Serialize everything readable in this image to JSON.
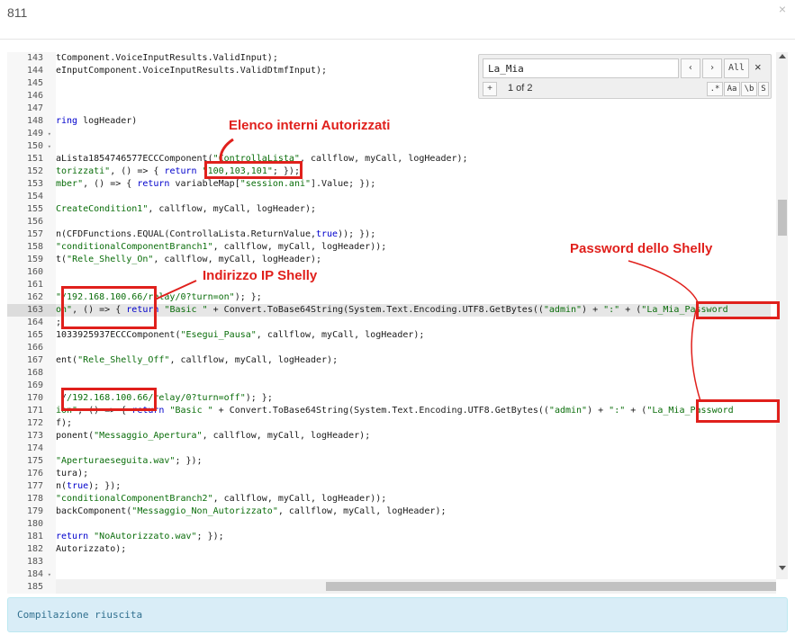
{
  "modal": {
    "title": "811",
    "close_glyph": "×"
  },
  "editor": {
    "lines": [
      {
        "n": "143",
        "fold": "",
        "segs": [
          {
            "t": "tComponent.VoiceInputResults.ValidInput);"
          }
        ]
      },
      {
        "n": "144",
        "fold": "",
        "segs": [
          {
            "t": "eInputComponent.VoiceInputResults.ValidDtmfInput);"
          }
        ]
      },
      {
        "n": "145",
        "fold": "",
        "segs": []
      },
      {
        "n": "146",
        "fold": "",
        "segs": []
      },
      {
        "n": "147",
        "fold": "",
        "segs": []
      },
      {
        "n": "148",
        "fold": "",
        "segs": [
          {
            "t": "ring",
            "c": "kw"
          },
          {
            "t": " logHeader)"
          }
        ]
      },
      {
        "n": "149",
        "fold": "▾",
        "segs": []
      },
      {
        "n": "150",
        "fold": "▾",
        "segs": []
      },
      {
        "n": "151",
        "fold": "",
        "segs": [
          {
            "t": "aLista1854746577ECCComponent("
          },
          {
            "t": "\"ControllaLista\"",
            "c": "str"
          },
          {
            "t": ", callflow, myCall, logHeader);"
          }
        ]
      },
      {
        "n": "152",
        "fold": "",
        "segs": [
          {
            "t": "torizzati\"",
            "c": "str"
          },
          {
            "t": ", () => { "
          },
          {
            "t": "return",
            "c": "kw"
          },
          {
            "t": " "
          },
          {
            "t": "\"100,103,101\"",
            "c": "str"
          },
          {
            "t": "; });"
          }
        ]
      },
      {
        "n": "153",
        "fold": "",
        "segs": [
          {
            "t": "mber\"",
            "c": "str"
          },
          {
            "t": ", () => { "
          },
          {
            "t": "return",
            "c": "kw"
          },
          {
            "t": " variableMap["
          },
          {
            "t": "\"session.ani\"",
            "c": "str"
          },
          {
            "t": "].Value; });"
          }
        ]
      },
      {
        "n": "154",
        "fold": "",
        "segs": []
      },
      {
        "n": "155",
        "fold": "",
        "segs": [
          {
            "t": "CreateCondition1\"",
            "c": "str"
          },
          {
            "t": ", callflow, myCall, logHeader);"
          }
        ]
      },
      {
        "n": "156",
        "fold": "",
        "segs": []
      },
      {
        "n": "157",
        "fold": "",
        "segs": [
          {
            "t": "n(CFDFunctions.EQUAL(ControllaLista.ReturnValue,"
          },
          {
            "t": "true",
            "c": "kw"
          },
          {
            "t": ")); });"
          }
        ]
      },
      {
        "n": "158",
        "fold": "",
        "segs": [
          {
            "t": "\"conditionalComponentBranch1\"",
            "c": "str"
          },
          {
            "t": ", callflow, myCall, logHeader));"
          }
        ]
      },
      {
        "n": "159",
        "fold": "",
        "segs": [
          {
            "t": "t("
          },
          {
            "t": "\"Rele_Shelly_On\"",
            "c": "str"
          },
          {
            "t": ", callflow, myCall, logHeader);"
          }
        ]
      },
      {
        "n": "160",
        "fold": "",
        "segs": []
      },
      {
        "n": "161",
        "fold": "",
        "segs": []
      },
      {
        "n": "162",
        "fold": "",
        "segs": [
          {
            "t": "\"/192.168.100.66/relay/0?turn=on\"",
            "c": "str"
          },
          {
            "t": "); };"
          }
        ]
      },
      {
        "n": "163",
        "fold": "",
        "segs": [
          {
            "t": "on\"",
            "c": "str"
          },
          {
            "t": ", () => { "
          },
          {
            "t": "return",
            "c": "kw"
          },
          {
            "t": " "
          },
          {
            "t": "\"Basic \"",
            "c": "str"
          },
          {
            "t": " + Convert.ToBase64String(System.Text.Encoding.UTF8.GetBytes(("
          },
          {
            "t": "\"admin\"",
            "c": "str"
          },
          {
            "t": ") + "
          },
          {
            "t": "\":\"",
            "c": "str"
          },
          {
            "t": " + ("
          },
          {
            "t": "\"La_Mia_Password",
            "c": "str"
          }
        ]
      },
      {
        "n": "164",
        "fold": "",
        "segs": [
          {
            "t": ";"
          }
        ]
      },
      {
        "n": "165",
        "fold": "",
        "segs": [
          {
            "t": "1033925937ECCComponent("
          },
          {
            "t": "\"Esegui_Pausa\"",
            "c": "str"
          },
          {
            "t": ", callflow, myCall, logHeader);"
          }
        ]
      },
      {
        "n": "166",
        "fold": "",
        "segs": []
      },
      {
        "n": "167",
        "fold": "",
        "segs": [
          {
            "t": "ent("
          },
          {
            "t": "\"Rele_Shelly_Off\"",
            "c": "str"
          },
          {
            "t": ", callflow, myCall, logHeader);"
          }
        ]
      },
      {
        "n": "168",
        "fold": "",
        "segs": []
      },
      {
        "n": "169",
        "fold": "",
        "segs": []
      },
      {
        "n": "170",
        "fold": "",
        "segs": [
          {
            "t": " /"
          },
          {
            "t": "/192.168.100.66/relay/0?turn=off\"",
            "c": "str"
          },
          {
            "t": "); };"
          }
        ]
      },
      {
        "n": "171",
        "fold": "",
        "segs": [
          {
            "t": "ion\"",
            "c": "str"
          },
          {
            "t": ", () => { "
          },
          {
            "t": "return",
            "c": "kw"
          },
          {
            "t": " "
          },
          {
            "t": "\"Basic \"",
            "c": "str"
          },
          {
            "t": " + Convert.ToBase64String(System.Text.Encoding.UTF8.GetBytes(("
          },
          {
            "t": "\"admin\"",
            "c": "str"
          },
          {
            "t": ") + "
          },
          {
            "t": "\":\"",
            "c": "str"
          },
          {
            "t": " + ("
          },
          {
            "t": "\"La_Mia_Password",
            "c": "str"
          }
        ]
      },
      {
        "n": "172",
        "fold": "",
        "segs": [
          {
            "t": "f);"
          }
        ]
      },
      {
        "n": "173",
        "fold": "",
        "segs": [
          {
            "t": "ponent("
          },
          {
            "t": "\"Messaggio_Apertura\"",
            "c": "str"
          },
          {
            "t": ", callflow, myCall, logHeader);"
          }
        ]
      },
      {
        "n": "174",
        "fold": "",
        "segs": []
      },
      {
        "n": "175",
        "fold": "",
        "segs": [
          {
            "t": "\"Aperturaeseguita.wav\"",
            "c": "str"
          },
          {
            "t": "; });"
          }
        ]
      },
      {
        "n": "176",
        "fold": "",
        "segs": [
          {
            "t": "tura);"
          }
        ]
      },
      {
        "n": "177",
        "fold": "",
        "segs": [
          {
            "t": "n("
          },
          {
            "t": "true",
            "c": "kw"
          },
          {
            "t": "); });"
          }
        ]
      },
      {
        "n": "178",
        "fold": "",
        "segs": [
          {
            "t": "\"conditionalComponentBranch2\"",
            "c": "str"
          },
          {
            "t": ", callflow, myCall, logHeader));"
          }
        ]
      },
      {
        "n": "179",
        "fold": "",
        "segs": [
          {
            "t": "backComponent("
          },
          {
            "t": "\"Messaggio_Non_Autorizzato\"",
            "c": "str"
          },
          {
            "t": ", callflow, myCall, logHeader);"
          }
        ]
      },
      {
        "n": "180",
        "fold": "",
        "segs": []
      },
      {
        "n": "181",
        "fold": "",
        "segs": [
          {
            "t": "return",
            "c": "kw"
          },
          {
            "t": " "
          },
          {
            "t": "\"NoAutorizzato.wav\"",
            "c": "str"
          },
          {
            "t": "; });"
          }
        ]
      },
      {
        "n": "182",
        "fold": "",
        "segs": [
          {
            "t": "Autorizzato);"
          }
        ]
      },
      {
        "n": "183",
        "fold": "",
        "segs": []
      },
      {
        "n": "184",
        "fold": "▾",
        "segs": []
      },
      {
        "n": "185",
        "fold": "",
        "segs": []
      }
    ],
    "active_line": "163"
  },
  "search": {
    "query": "La_Mia",
    "prev_glyph": "‹",
    "next_glyph": "›",
    "all_label": "All",
    "close_glyph": "×",
    "replace_toggle": "+",
    "count": "1 of 2",
    "opt_regex": ".*",
    "opt_case": "Aa",
    "opt_word": "\\b",
    "opt_selection": "S"
  },
  "annotations": {
    "allowed_extensions": "Elenco interni Autorizzati",
    "shelly_ip": "Indirizzo IP Shelly",
    "shelly_password": "Password dello Shelly",
    "color": "#e0201c"
  },
  "status": {
    "message": "Compilazione riuscita"
  }
}
